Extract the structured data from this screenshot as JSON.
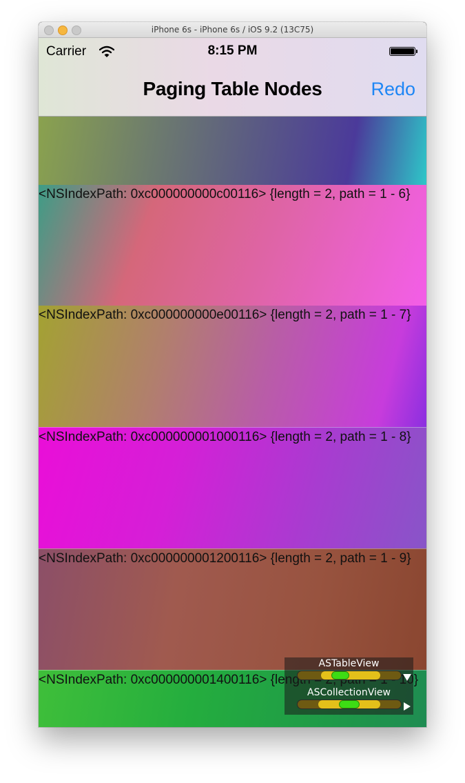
{
  "window": {
    "title": "iPhone 6s - iPhone 6s / iOS 9.2 (13C75)"
  },
  "status_bar": {
    "carrier": "Carrier",
    "time": "8:15 PM"
  },
  "nav": {
    "title": "Paging Table Nodes",
    "redo_label": "Redo"
  },
  "cells": [
    {
      "text": ""
    },
    {
      "text": "<NSIndexPath: 0xc000000000c00116> {length = 2, path = 1 - 6}"
    },
    {
      "text": "<NSIndexPath: 0xc000000000e00116> {length = 2, path = 1 - 7}"
    },
    {
      "text": "<NSIndexPath: 0xc000000001000116> {length = 2, path = 1 - 8}"
    },
    {
      "text": "<NSIndexPath: 0xc000000001200116> {length = 2, path = 1 - 9}"
    },
    {
      "text": "<NSIndexPath: 0xc000000001400116> {length = 2, path = 1 - 10}"
    }
  ],
  "range_overlay": {
    "table_label": "ASTableView",
    "collection_label": "ASCollectionView"
  },
  "colors": {
    "accent": "#1e86f5",
    "range_green": "#3ddc14",
    "range_yellow": "#e3c01a"
  }
}
